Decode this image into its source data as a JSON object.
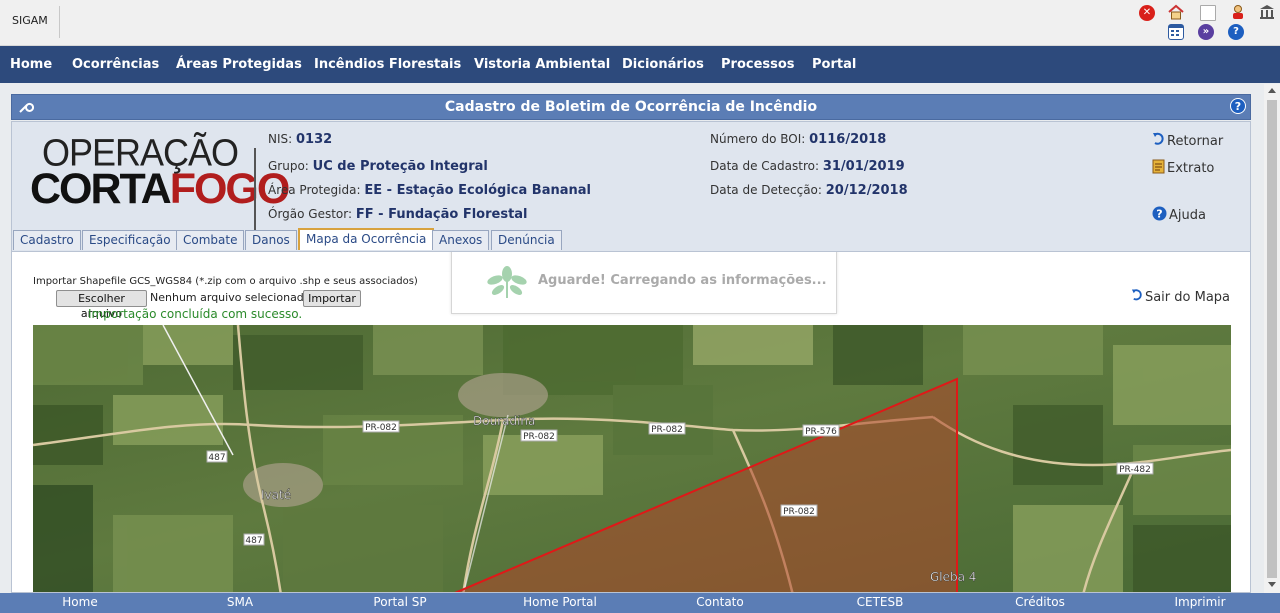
{
  "app": {
    "brand": "SIGAM"
  },
  "top_icons": [
    "close-icon",
    "home-icon",
    "broken-image-icon",
    "user-icon",
    "building-icon",
    "calendar-icon",
    "chevron-down-circle-icon",
    "help-icon"
  ],
  "nav": [
    "Home",
    "Ocorrências",
    "Áreas Protegidas",
    "Incêndios Florestais",
    "Vistoria Ambiental",
    "Dicionários",
    "Processos",
    "Portal"
  ],
  "panel": {
    "title": "Cadastro de Boletim de Ocorrência de Incêndio"
  },
  "logo": {
    "line1": "OPERAÇÃO",
    "line2a": "CORTA",
    "line2b": "FOGO"
  },
  "record": {
    "nis_label": "NIS:",
    "nis": "0132",
    "grupo_label": "Grupo:",
    "grupo": "UC de Proteção Integral",
    "area_label": "Área Protegida:",
    "area": "EE - Estação Ecológica Bananal",
    "orgao_label": "Órgão Gestor:",
    "orgao": "FF - Fundação Florestal",
    "boi_label": "Número do BOI:",
    "boi": "0116/2018",
    "cadastro_label": "Data de Cadastro:",
    "cadastro": "31/01/2019",
    "deteccao_label": "Data de Detecção:",
    "deteccao": "20/12/2018"
  },
  "side_links": {
    "retornar": "Retornar",
    "extrato": "Extrato",
    "ajuda": "Ajuda"
  },
  "tabs": [
    "Cadastro",
    "Especificação",
    "Combate",
    "Danos",
    "Mapa da Ocorrência",
    "Anexos",
    "Denúncia"
  ],
  "active_tab": "Mapa da Ocorrência",
  "import": {
    "label": "Importar Shapefile GCS_WGS84 (*.zip com o arquivo .shp e seus associados)",
    "choose_button": "Escolher arquivo",
    "file_status": "Nenhum arquivo selecionado",
    "import_button": "Importar",
    "success": "Importação concluída com sucesso."
  },
  "loading": {
    "text": "Aguarde! Carregando as informações..."
  },
  "exit_map": "Sair do Mapa",
  "map": {
    "places": [
      "Douradina",
      "Ivaté",
      "Gleba 4"
    ],
    "roads": [
      "PR-082",
      "PR-082",
      "PR-082",
      "PR-576",
      "PR-082",
      "PR-482",
      "487",
      "487"
    ],
    "polygon_color": "#d01818"
  },
  "footer": [
    "Home",
    "SMA",
    "Portal SP",
    "Home Portal",
    "Contato",
    "CETESB",
    "Créditos",
    "Imprimir"
  ]
}
